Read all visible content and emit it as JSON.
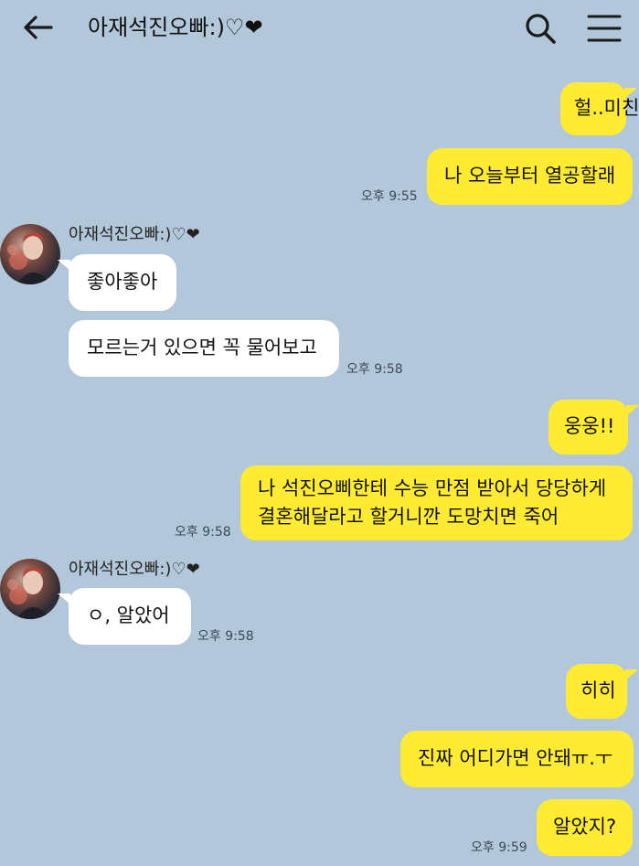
{
  "header": {
    "title": "아재석진오빠:)♡❤︎",
    "back_icon": "arrow-left-icon",
    "search_icon": "search-icon",
    "menu_icon": "hamburger-menu-icon"
  },
  "colors": {
    "background": "#b2c7da",
    "my_bubble": "#ffeb33",
    "other_bubble": "#ffffff"
  },
  "messages": [
    {
      "from": "me",
      "text": "헐..미친"
    },
    {
      "from": "me",
      "text": "나 오늘부터 열공할래",
      "time": "오후 9:55"
    },
    {
      "from": "other",
      "sender": "아재석진오빠:)♡❤︎",
      "text": "좋아좋아"
    },
    {
      "from": "other",
      "text": "모르는거 있으면 꼭 물어보고",
      "time": "오후 9:58"
    },
    {
      "from": "me",
      "text": "웅웅!!"
    },
    {
      "from": "me",
      "lines": [
        "나 석진오삐한테 수능 만점 받아서 당당하게",
        "결혼해달라고 할거니깐 도망치면 죽어"
      ],
      "time": "오후 9:58"
    },
    {
      "from": "other",
      "sender": "아재석진오빠:)♡❤︎",
      "text": "ㅇ, 알았어",
      "time": "오후 9:58"
    },
    {
      "from": "me",
      "text": "히히"
    },
    {
      "from": "me",
      "text": "진짜 어디가면 안돼ㅠ.ㅜ"
    },
    {
      "from": "me",
      "text": "알았지?",
      "time": "오후 9:59"
    }
  ]
}
